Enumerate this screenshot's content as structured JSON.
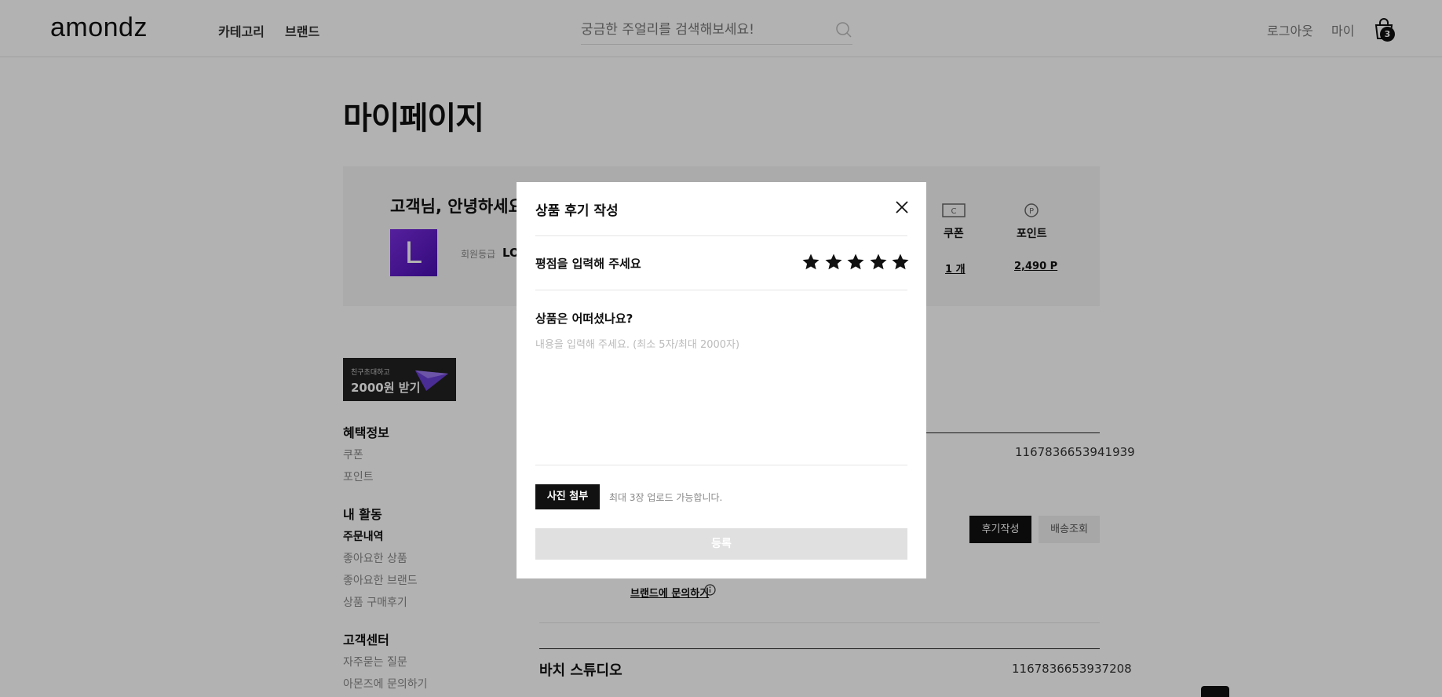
{
  "header": {
    "logo": "amondz",
    "nav": [
      "카테고리",
      "브랜드"
    ],
    "search_placeholder": "궁금한 주얼리를 검색해보세요!",
    "logout": "로그아웃",
    "my": "마이",
    "cart_count": "3"
  },
  "mypage": {
    "title": "마이페이지",
    "greeting": "고객님, 안녕하세요!",
    "grade_letter": "L",
    "grade_label": "회원등급",
    "grade_value": "LO",
    "coupon_label": "쿠폰",
    "coupon_value": "1 개",
    "point_label": "포인트",
    "point_value": "2,490 P"
  },
  "invite": {
    "small": "친구초대하고",
    "big": "2000원 받기"
  },
  "sidebar": {
    "benefit_head": "혜택정보",
    "benefit_items": [
      "쿠폰",
      "포인트"
    ],
    "activity_head": "내 활동",
    "activity_items": [
      "주문내역",
      "좋아요한 상품",
      "좋아요한 브랜드",
      "상품 구매후기"
    ],
    "support_head": "고객센터",
    "support_items": [
      "자주묻는 질문",
      "아몬즈에 문의하기"
    ]
  },
  "orders": {
    "order1_no": "1167836653941939",
    "review_btn": "후기작성",
    "ship_btn": "배송조회",
    "brand_inquiry": "브랜드에 문의하기",
    "shop2": "바치 스튜디오",
    "order2_no": "1167836653937208"
  },
  "modal": {
    "title": "상품 후기 작성",
    "rating_label": "평점을 입력해 주세요",
    "rating": 5,
    "question": "상품은 어떠셨나요?",
    "review_placeholder": "내용을 입력해 주세요. (최소 5자/최대 2000자)",
    "photo_btn": "사진 첨부",
    "photo_note": "최대 3장 업로드 가능합니다.",
    "submit": "등록"
  }
}
